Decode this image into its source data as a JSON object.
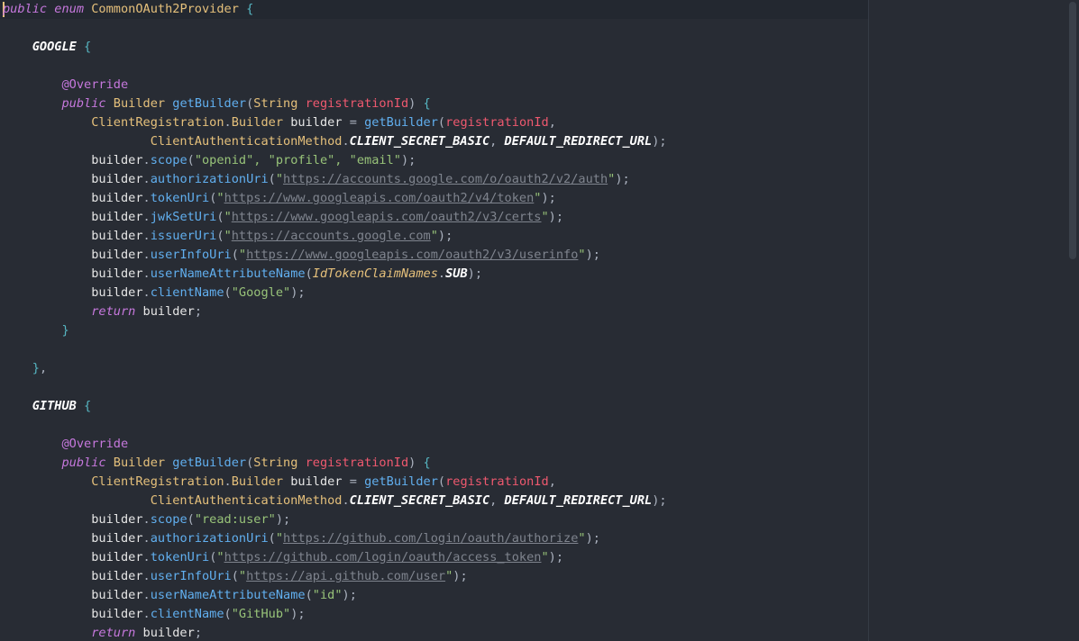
{
  "code": {
    "enum_name": "CommonOAuth2Provider",
    "google": {
      "name": "GOOGLE",
      "scope_args": "\"openid\", \"profile\", \"email\"",
      "auth_uri": "https://accounts.google.com/o/oauth2/v2/auth",
      "token_uri": "https://www.googleapis.com/oauth2/v4/token",
      "jwk_uri": "https://www.googleapis.com/oauth2/v3/certs",
      "issuer_uri": "https://accounts.google.com",
      "userinfo_uri": "https://www.googleapis.com/oauth2/v3/userinfo",
      "client_name": "\"Google\""
    },
    "github": {
      "name": "GITHUB",
      "scope_args": "\"read:user\"",
      "auth_uri": "https://github.com/login/oauth/authorize",
      "token_uri": "https://github.com/login/oauth/access_token",
      "userinfo_uri": "https://api.github.com/user",
      "user_name_attr": "\"id\"",
      "client_name": "\"GitHub\""
    },
    "kw": {
      "public": "public",
      "enum": "enum",
      "return": "return"
    },
    "annotation": "@Override",
    "types": {
      "builder": "Builder",
      "string": "String",
      "client_registration": "ClientRegistration",
      "client_auth_method": "ClientAuthenticationMethod",
      "id_token_claims": "IdTokenClaimNames"
    },
    "methods": {
      "get_builder": "getBuilder",
      "scope": "scope",
      "authorization_uri": "authorizationUri",
      "token_uri": "tokenUri",
      "jwk_set_uri": "jwkSetUri",
      "issuer_uri": "issuerUri",
      "user_info_uri": "userInfoUri",
      "user_name_attribute_name": "userNameAttributeName",
      "client_name": "clientName"
    },
    "identifiers": {
      "registration_id": "registrationId",
      "builder_var": "builder",
      "client_secret_basic": "CLIENT_SECRET_BASIC",
      "default_redirect_url": "DEFAULT_REDIRECT_URL",
      "sub": "SUB"
    }
  },
  "colors": {
    "background": "#282c34",
    "keyword": "#c678dd",
    "type": "#e5c07b",
    "function": "#61afef",
    "parameter": "#ef596f",
    "string": "#98c379",
    "url": "#7f848e"
  }
}
